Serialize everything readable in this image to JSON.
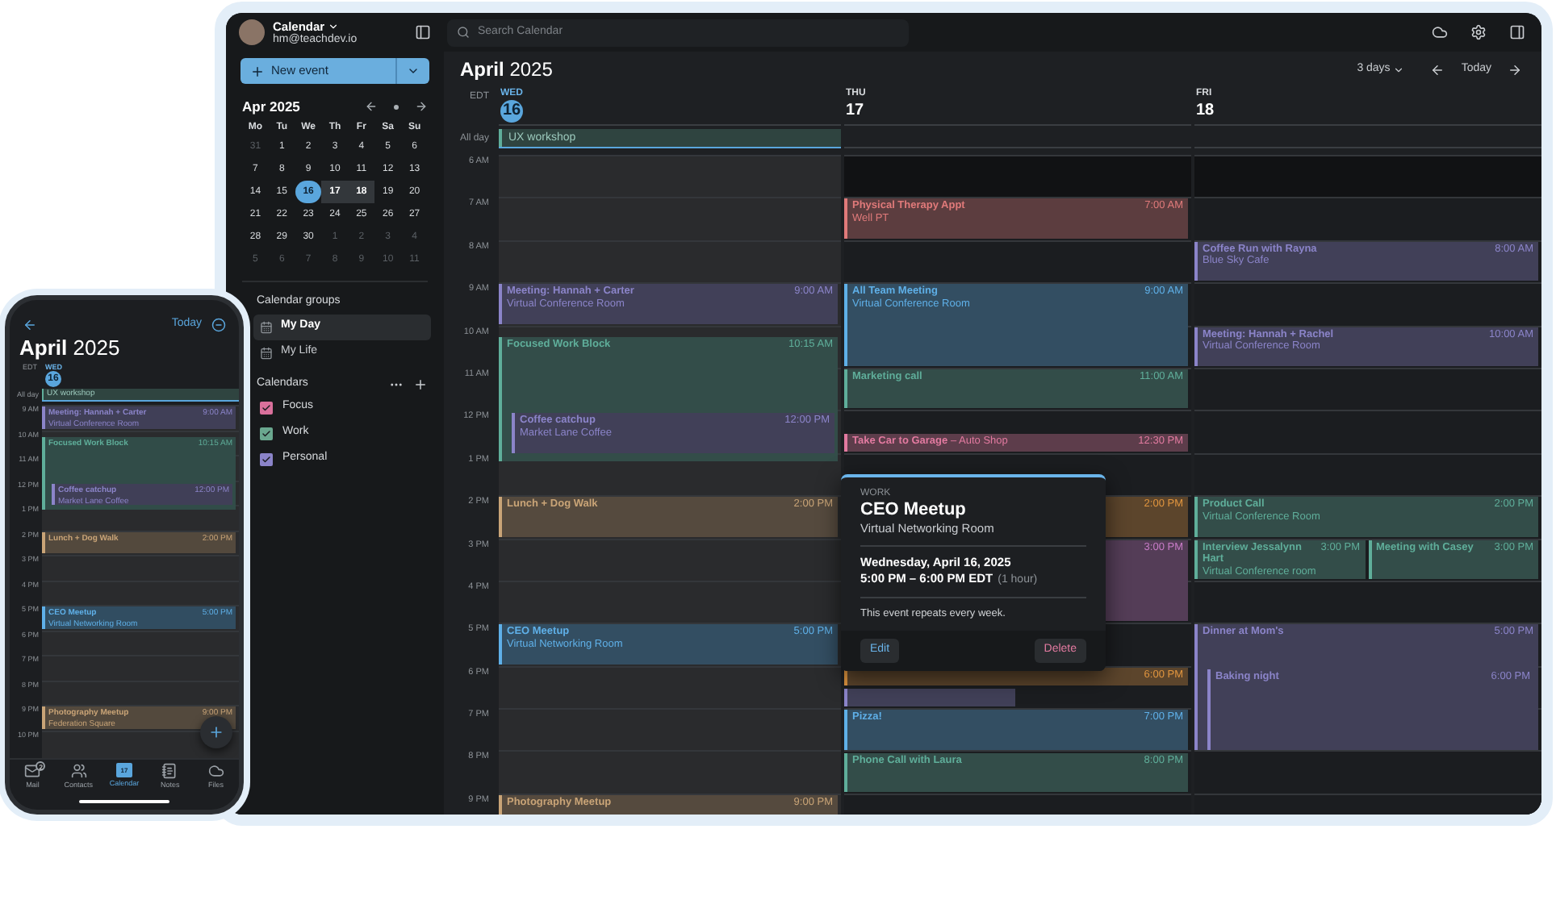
{
  "desktop": {
    "account": {
      "name": "Calendar",
      "email": "hm@teachdev.io"
    },
    "search": {
      "placeholder": "Search Calendar"
    },
    "new_event_button": "New event",
    "mini_calendar": {
      "title": "Apr 2025",
      "weekdays": [
        "Mo",
        "Tu",
        "We",
        "Th",
        "Fr",
        "Sa",
        "Su"
      ],
      "weeks": [
        [
          {
            "day": "31",
            "muted": true,
            "selected": false,
            "in_range": false
          },
          {
            "day": "1",
            "muted": false,
            "selected": false,
            "in_range": false
          },
          {
            "day": "2",
            "muted": false,
            "selected": false,
            "in_range": false
          },
          {
            "day": "3",
            "muted": false,
            "selected": false,
            "in_range": false
          },
          {
            "day": "4",
            "muted": false,
            "selected": false,
            "in_range": false
          },
          {
            "day": "5",
            "muted": false,
            "selected": false,
            "in_range": false
          },
          {
            "day": "6",
            "muted": false,
            "selected": false,
            "in_range": false
          }
        ],
        [
          {
            "day": "7",
            "muted": false,
            "selected": false,
            "in_range": false
          },
          {
            "day": "8",
            "muted": false,
            "selected": false,
            "in_range": false
          },
          {
            "day": "9",
            "muted": false,
            "selected": false,
            "in_range": false
          },
          {
            "day": "10",
            "muted": false,
            "selected": false,
            "in_range": false
          },
          {
            "day": "11",
            "muted": false,
            "selected": false,
            "in_range": false
          },
          {
            "day": "12",
            "muted": false,
            "selected": false,
            "in_range": false
          },
          {
            "day": "13",
            "muted": false,
            "selected": false,
            "in_range": false
          }
        ],
        [
          {
            "day": "14",
            "muted": false,
            "selected": false,
            "in_range": false
          },
          {
            "day": "15",
            "muted": false,
            "selected": false,
            "in_range": false
          },
          {
            "day": "16",
            "muted": false,
            "selected": true,
            "in_range": false
          },
          {
            "day": "17",
            "muted": false,
            "selected": false,
            "in_range": true
          },
          {
            "day": "18",
            "muted": false,
            "selected": false,
            "in_range": true
          },
          {
            "day": "19",
            "muted": false,
            "selected": false,
            "in_range": false
          },
          {
            "day": "20",
            "muted": false,
            "selected": false,
            "in_range": false
          }
        ],
        [
          {
            "day": "21",
            "muted": false,
            "selected": false,
            "in_range": false
          },
          {
            "day": "22",
            "muted": false,
            "selected": false,
            "in_range": false
          },
          {
            "day": "23",
            "muted": false,
            "selected": false,
            "in_range": false
          },
          {
            "day": "24",
            "muted": false,
            "selected": false,
            "in_range": false
          },
          {
            "day": "25",
            "muted": false,
            "selected": false,
            "in_range": false
          },
          {
            "day": "26",
            "muted": false,
            "selected": false,
            "in_range": false
          },
          {
            "day": "27",
            "muted": false,
            "selected": false,
            "in_range": false
          }
        ],
        [
          {
            "day": "28",
            "muted": false,
            "selected": false,
            "in_range": false
          },
          {
            "day": "29",
            "muted": false,
            "selected": false,
            "in_range": false
          },
          {
            "day": "30",
            "muted": false,
            "selected": false,
            "in_range": false
          },
          {
            "day": "1",
            "muted": true,
            "selected": false,
            "in_range": false
          },
          {
            "day": "2",
            "muted": true,
            "selected": false,
            "in_range": false
          },
          {
            "day": "3",
            "muted": true,
            "selected": false,
            "in_range": false
          },
          {
            "day": "4",
            "muted": true,
            "selected": false,
            "in_range": false
          }
        ],
        [
          {
            "day": "5",
            "muted": true,
            "selected": false,
            "in_range": false
          },
          {
            "day": "6",
            "muted": true,
            "selected": false,
            "in_range": false
          },
          {
            "day": "7",
            "muted": true,
            "selected": false,
            "in_range": false
          },
          {
            "day": "8",
            "muted": true,
            "selected": false,
            "in_range": false
          },
          {
            "day": "9",
            "muted": true,
            "selected": false,
            "in_range": false
          },
          {
            "day": "10",
            "muted": true,
            "selected": false,
            "in_range": false
          },
          {
            "day": "11",
            "muted": true,
            "selected": false,
            "in_range": false
          }
        ]
      ]
    },
    "calendar_groups": {
      "title": "Calendar groups",
      "items": [
        {
          "label": "My Day",
          "selected": true
        },
        {
          "label": "My Life",
          "selected": false
        }
      ]
    },
    "calendars": {
      "title": "Calendars",
      "items": [
        {
          "label": "Focus",
          "checked": true,
          "color": "#d9709b"
        },
        {
          "label": "Work",
          "checked": true,
          "color": "#6aa88f"
        },
        {
          "label": "Personal",
          "checked": true,
          "color": "#8b84c9"
        }
      ]
    },
    "header": {
      "month": "April",
      "year": "2025",
      "view": "3 days",
      "today": "Today"
    },
    "timezone": "EDT",
    "all_day_label": "All day",
    "hours": [
      "6 AM",
      "7 AM",
      "8 AM",
      "9 AM",
      "10 AM",
      "11 AM",
      "12 PM",
      "1 PM",
      "2 PM",
      "3 PM",
      "4 PM",
      "5 PM",
      "6 PM",
      "7 PM",
      "8 PM",
      "9 PM"
    ],
    "days": [
      {
        "weekday": "WED",
        "date": "16",
        "selected": true,
        "all_day": [
          "UX workshop"
        ],
        "events": [
          {
            "kind": "block",
            "title": "Meeting: Hannah + Carter",
            "location": "Virtual Conference Room",
            "time": "9:00 AM",
            "color": "#8b84c9"
          },
          {
            "kind": "block",
            "title": "Focused Work Block",
            "time": "10:15 AM",
            "color": "#5fae9a"
          },
          {
            "kind": "block",
            "title": "Coffee catchup",
            "location": "Market Lane Coffee",
            "time": "12:00 PM",
            "color": "#8b84c9"
          },
          {
            "kind": "block",
            "title": "Lunch + Dog Walk",
            "time": "2:00 PM",
            "color": "#c9a477"
          },
          {
            "kind": "block",
            "title": "CEO Meetup",
            "location": "Virtual Networking Room",
            "time": "5:00 PM",
            "color": "#5fb0e8"
          },
          {
            "kind": "block",
            "title": "Photography Meetup",
            "time": "9:00 PM",
            "color": "#c9a477"
          }
        ]
      },
      {
        "weekday": "THU",
        "date": "17",
        "selected": false,
        "events": [
          {
            "kind": "block",
            "title": "Physical Therapy Appt",
            "location": "Well PT",
            "time": "7:00 AM",
            "color": "#e07a7a"
          },
          {
            "kind": "block",
            "title": "All Team Meeting",
            "location": "Virtual Conference Room",
            "time": "9:00 AM",
            "color": "#5fb0e8"
          },
          {
            "kind": "block",
            "title": "Marketing call",
            "time": "11:00 AM",
            "color": "#5fae9a"
          },
          {
            "kind": "inline",
            "title": "Take Car to Garage",
            "location": "– Auto Shop",
            "time": "12:30 PM",
            "color": "#e27aa0"
          },
          {
            "kind": "block",
            "time": "2:00 PM",
            "color": "#e0953f"
          },
          {
            "kind": "block",
            "time": "3:00 PM",
            "color": "#c77bc6"
          },
          {
            "kind": "block",
            "time": "6:00 PM",
            "color": "#e0953f"
          },
          {
            "kind": "block",
            "color": "#8b84c9"
          },
          {
            "kind": "block",
            "title": "Pizza!",
            "time": "7:00 PM",
            "color": "#5fb0e8"
          },
          {
            "kind": "block",
            "title": "Phone Call with Laura",
            "time": "8:00 PM",
            "color": "#5fae9a"
          }
        ]
      },
      {
        "weekday": "FRI",
        "date": "18",
        "selected": false,
        "events": [
          {
            "kind": "block",
            "title": "Coffee Run with Rayna",
            "location": "Blue Sky Cafe",
            "time": "8:00 AM",
            "color": "#8b84c9"
          },
          {
            "kind": "block",
            "title": "Meeting: Hannah + Rachel",
            "location": "Virtual Conference Room",
            "time": "10:00 AM",
            "color": "#8b84c9"
          },
          {
            "kind": "block",
            "title": "Product Call",
            "location": "Virtual Conference Room",
            "time": "2:00 PM",
            "color": "#5fae9a"
          },
          {
            "kind": "block",
            "title": "Interview Jessalynn Hart",
            "location": "Virtual Conference room",
            "time": "3:00 PM",
            "color": "#5fae9a"
          },
          {
            "kind": "block",
            "title": "Meeting with Casey",
            "time": "3:00 PM",
            "color": "#5fae9a"
          },
          {
            "kind": "block",
            "title": "Dinner at Mom's",
            "time": "5:00 PM",
            "color": "#8b84c9"
          },
          {
            "kind": "block",
            "title": "Baking night",
            "time": "6:00 PM",
            "color": "#8b84c9"
          }
        ]
      }
    ],
    "popup": {
      "category": "WORK",
      "title": "CEO Meetup",
      "location": "Virtual Networking Room",
      "date": "Wednesday, April 16, 2025",
      "time": "5:00 PM – 6:00 PM EDT",
      "duration": "(1 hour)",
      "note": "This event repeats every week.",
      "buttons": [
        "Edit",
        "Delete"
      ]
    }
  },
  "phone": {
    "today": "Today",
    "month": "April",
    "year": "2025",
    "timezone": "EDT",
    "weekday": "WED",
    "date": "16",
    "all_day_label": "All day",
    "all_day": [
      "UX workshop"
    ],
    "hours": [
      "9 AM",
      "10 AM",
      "11 AM",
      "12 PM",
      "1 PM",
      "2 PM",
      "3 PM",
      "4 PM",
      "5 PM",
      "6 PM",
      "7 PM",
      "8 PM",
      "9 PM",
      "10 PM"
    ],
    "events": [
      {
        "title": "Meeting: Hannah + Carter",
        "location": "Virtual Conference Room",
        "time": "9:00 AM",
        "color": "#8b84c9"
      },
      {
        "title": "Focused Work Block",
        "time": "10:15 AM",
        "color": "#5fae9a"
      },
      {
        "title": "Coffee catchup",
        "location": "Market Lane Coffee",
        "time": "12:00 PM",
        "color": "#8b84c9"
      },
      {
        "title": "Lunch + Dog Walk",
        "time": "2:00 PM",
        "color": "#c9a477"
      },
      {
        "title": "CEO Meetup",
        "location": "Virtual Networking Room",
        "time": "5:00 PM",
        "color": "#5fb0e8"
      },
      {
        "title": "Photography Meetup",
        "location": "Federation Square",
        "time": "9:00 PM",
        "color": "#c9a477"
      }
    ],
    "tabs": [
      {
        "kind": "mail",
        "label": "Mail",
        "badge": "2",
        "selected": false
      },
      {
        "kind": "contacts",
        "label": "Contacts",
        "selected": false
      },
      {
        "kind": "calendar",
        "label": "Calendar",
        "icon_date": "17",
        "selected": true
      },
      {
        "kind": "notes",
        "label": "Notes",
        "selected": false
      },
      {
        "kind": "files",
        "label": "Files",
        "selected": false
      }
    ]
  }
}
